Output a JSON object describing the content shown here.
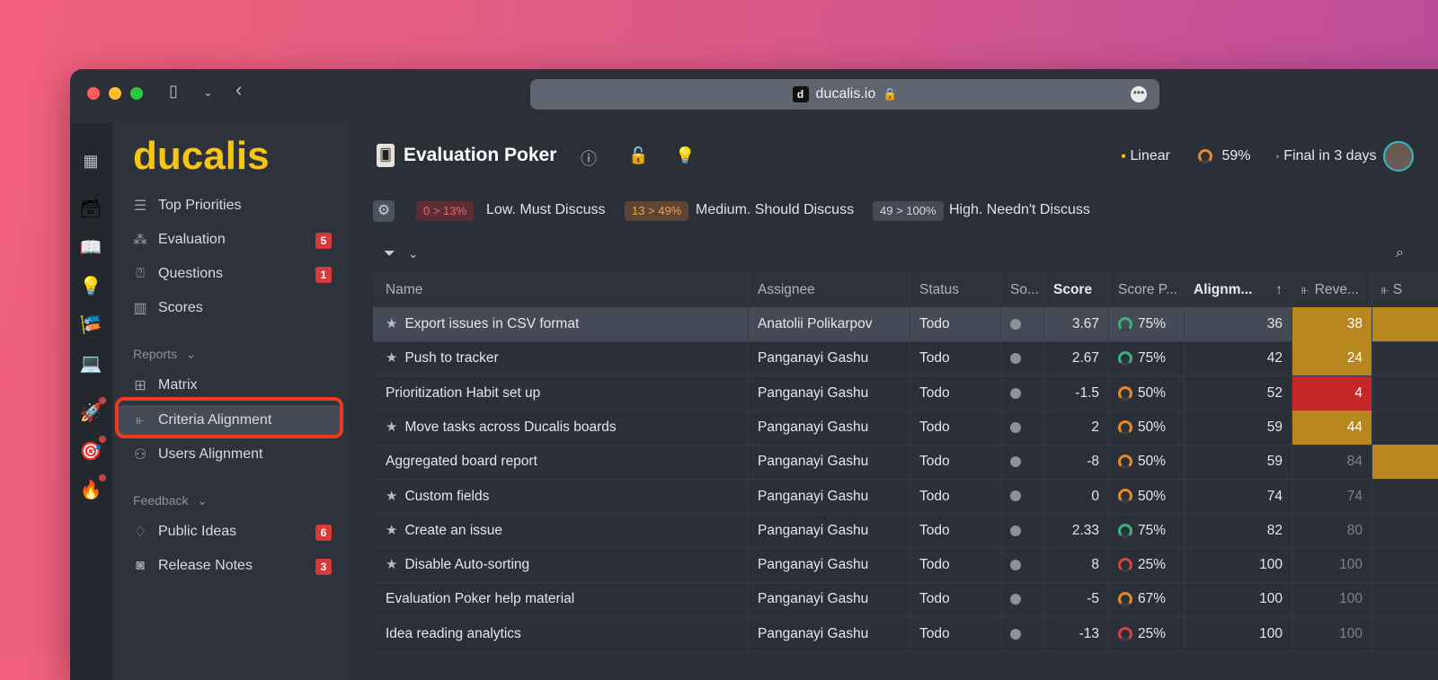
{
  "browser": {
    "url": "ducalis.io",
    "favicon_letter": "d"
  },
  "sidebar": {
    "logo": "ducalis",
    "items": [
      {
        "label": "Top Priorities",
        "icon": "list-icon"
      },
      {
        "label": "Evaluation",
        "icon": "evaluation-icon",
        "badge": "5"
      },
      {
        "label": "Questions",
        "icon": "questions-icon",
        "badge": "1"
      },
      {
        "label": "Scores",
        "icon": "scores-icon"
      }
    ],
    "reports_label": "Reports",
    "reports_items": [
      {
        "label": "Matrix",
        "icon": "matrix-icon"
      },
      {
        "label": "Criteria Alignment",
        "icon": "criteria-icon"
      },
      {
        "label": "Users Alignment",
        "icon": "users-icon"
      }
    ],
    "feedback_label": "Feedback",
    "feedback_items": [
      {
        "label": "Public Ideas",
        "icon": "idea-icon",
        "badge": "6"
      },
      {
        "label": "Release Notes",
        "icon": "release-icon",
        "badge": "3"
      }
    ]
  },
  "header": {
    "title": "Evaluation Poker",
    "integration": "Linear",
    "progress": "59%",
    "final": "Final in 3 days"
  },
  "legend": [
    {
      "range": "0 > 13%",
      "label": "Low. Must Discuss",
      "color": "#e26a6a",
      "bg": "#5a2e34"
    },
    {
      "range": "13 > 49%",
      "label": "Medium. Should Discuss",
      "color": "#e8a25a",
      "bg": "#5e4433"
    },
    {
      "range": "49 > 100%",
      "label": "High. Needn't Discuss",
      "color": "#d5d9de",
      "bg": "#444b56"
    }
  ],
  "table": {
    "columns": {
      "name": "Name",
      "assignee": "Assignee",
      "status": "Status",
      "source": "So...",
      "score": "Score",
      "score_p": "Score P...",
      "alignment": "Alignm...",
      "revenue": "Reve...",
      "extra": "S"
    },
    "rows": [
      {
        "starred": true,
        "name": "Export issues in CSV format",
        "assignee": "Anatolii Polikarpov",
        "status": "Todo",
        "score": "3.67",
        "pct": "75%",
        "ring": "#3ab27a",
        "align": "36",
        "rev": "38",
        "rev_bg": "#b8861f",
        "extra_bg": "#b8861f"
      },
      {
        "starred": true,
        "name": "Push to tracker",
        "assignee": "Panganayi Gashu",
        "status": "Todo",
        "score": "2.67",
        "pct": "75%",
        "ring": "#3ab27a",
        "align": "42",
        "rev": "24",
        "rev_bg": "#b8861f",
        "extra_bg": ""
      },
      {
        "starred": false,
        "name": "Prioritization Habit set up",
        "assignee": "Panganayi Gashu",
        "status": "Todo",
        "score": "-1.5",
        "pct": "50%",
        "ring": "#e38a2b",
        "align": "52",
        "rev": "4",
        "rev_bg": "#c42727",
        "extra_bg": ""
      },
      {
        "starred": true,
        "name": "Move tasks across Ducalis boards",
        "assignee": "Panganayi Gashu",
        "status": "Todo",
        "score": "2",
        "pct": "50%",
        "ring": "#e38a2b",
        "align": "59",
        "rev": "44",
        "rev_bg": "#b8861f",
        "extra_bg": ""
      },
      {
        "starred": false,
        "name": "Aggregated board report",
        "assignee": "Panganayi Gashu",
        "status": "Todo",
        "score": "-8",
        "pct": "50%",
        "ring": "#e38a2b",
        "align": "59",
        "rev": "84",
        "rev_bg": "",
        "extra_bg": "#b8861f"
      },
      {
        "starred": true,
        "name": "Custom fields",
        "assignee": "Panganayi Gashu",
        "status": "Todo",
        "score": "0",
        "pct": "50%",
        "ring": "#e38a2b",
        "align": "74",
        "rev": "74",
        "rev_bg": "",
        "extra_bg": ""
      },
      {
        "starred": true,
        "name": "Create an issue",
        "assignee": "Panganayi Gashu",
        "status": "Todo",
        "score": "2.33",
        "pct": "75%",
        "ring": "#3ab27a",
        "align": "82",
        "rev": "80",
        "rev_bg": "",
        "extra_bg": ""
      },
      {
        "starred": true,
        "name": "Disable Auto-sorting",
        "assignee": "Panganayi Gashu",
        "status": "Todo",
        "score": "8",
        "pct": "25%",
        "ring": "#d64343",
        "align": "100",
        "rev": "100",
        "rev_bg": "",
        "extra_bg": ""
      },
      {
        "starred": false,
        "name": "Evaluation Poker help material",
        "assignee": "Panganayi Gashu",
        "status": "Todo",
        "score": "-5",
        "pct": "67%",
        "ring": "#e38a2b",
        "align": "100",
        "rev": "100",
        "rev_bg": "",
        "extra_bg": ""
      },
      {
        "starred": false,
        "name": "Idea reading analytics",
        "assignee": "Panganayi Gashu",
        "status": "Todo",
        "score": "-13",
        "pct": "25%",
        "ring": "#d64343",
        "align": "100",
        "rev": "100",
        "rev_bg": "",
        "extra_bg": ""
      }
    ]
  }
}
